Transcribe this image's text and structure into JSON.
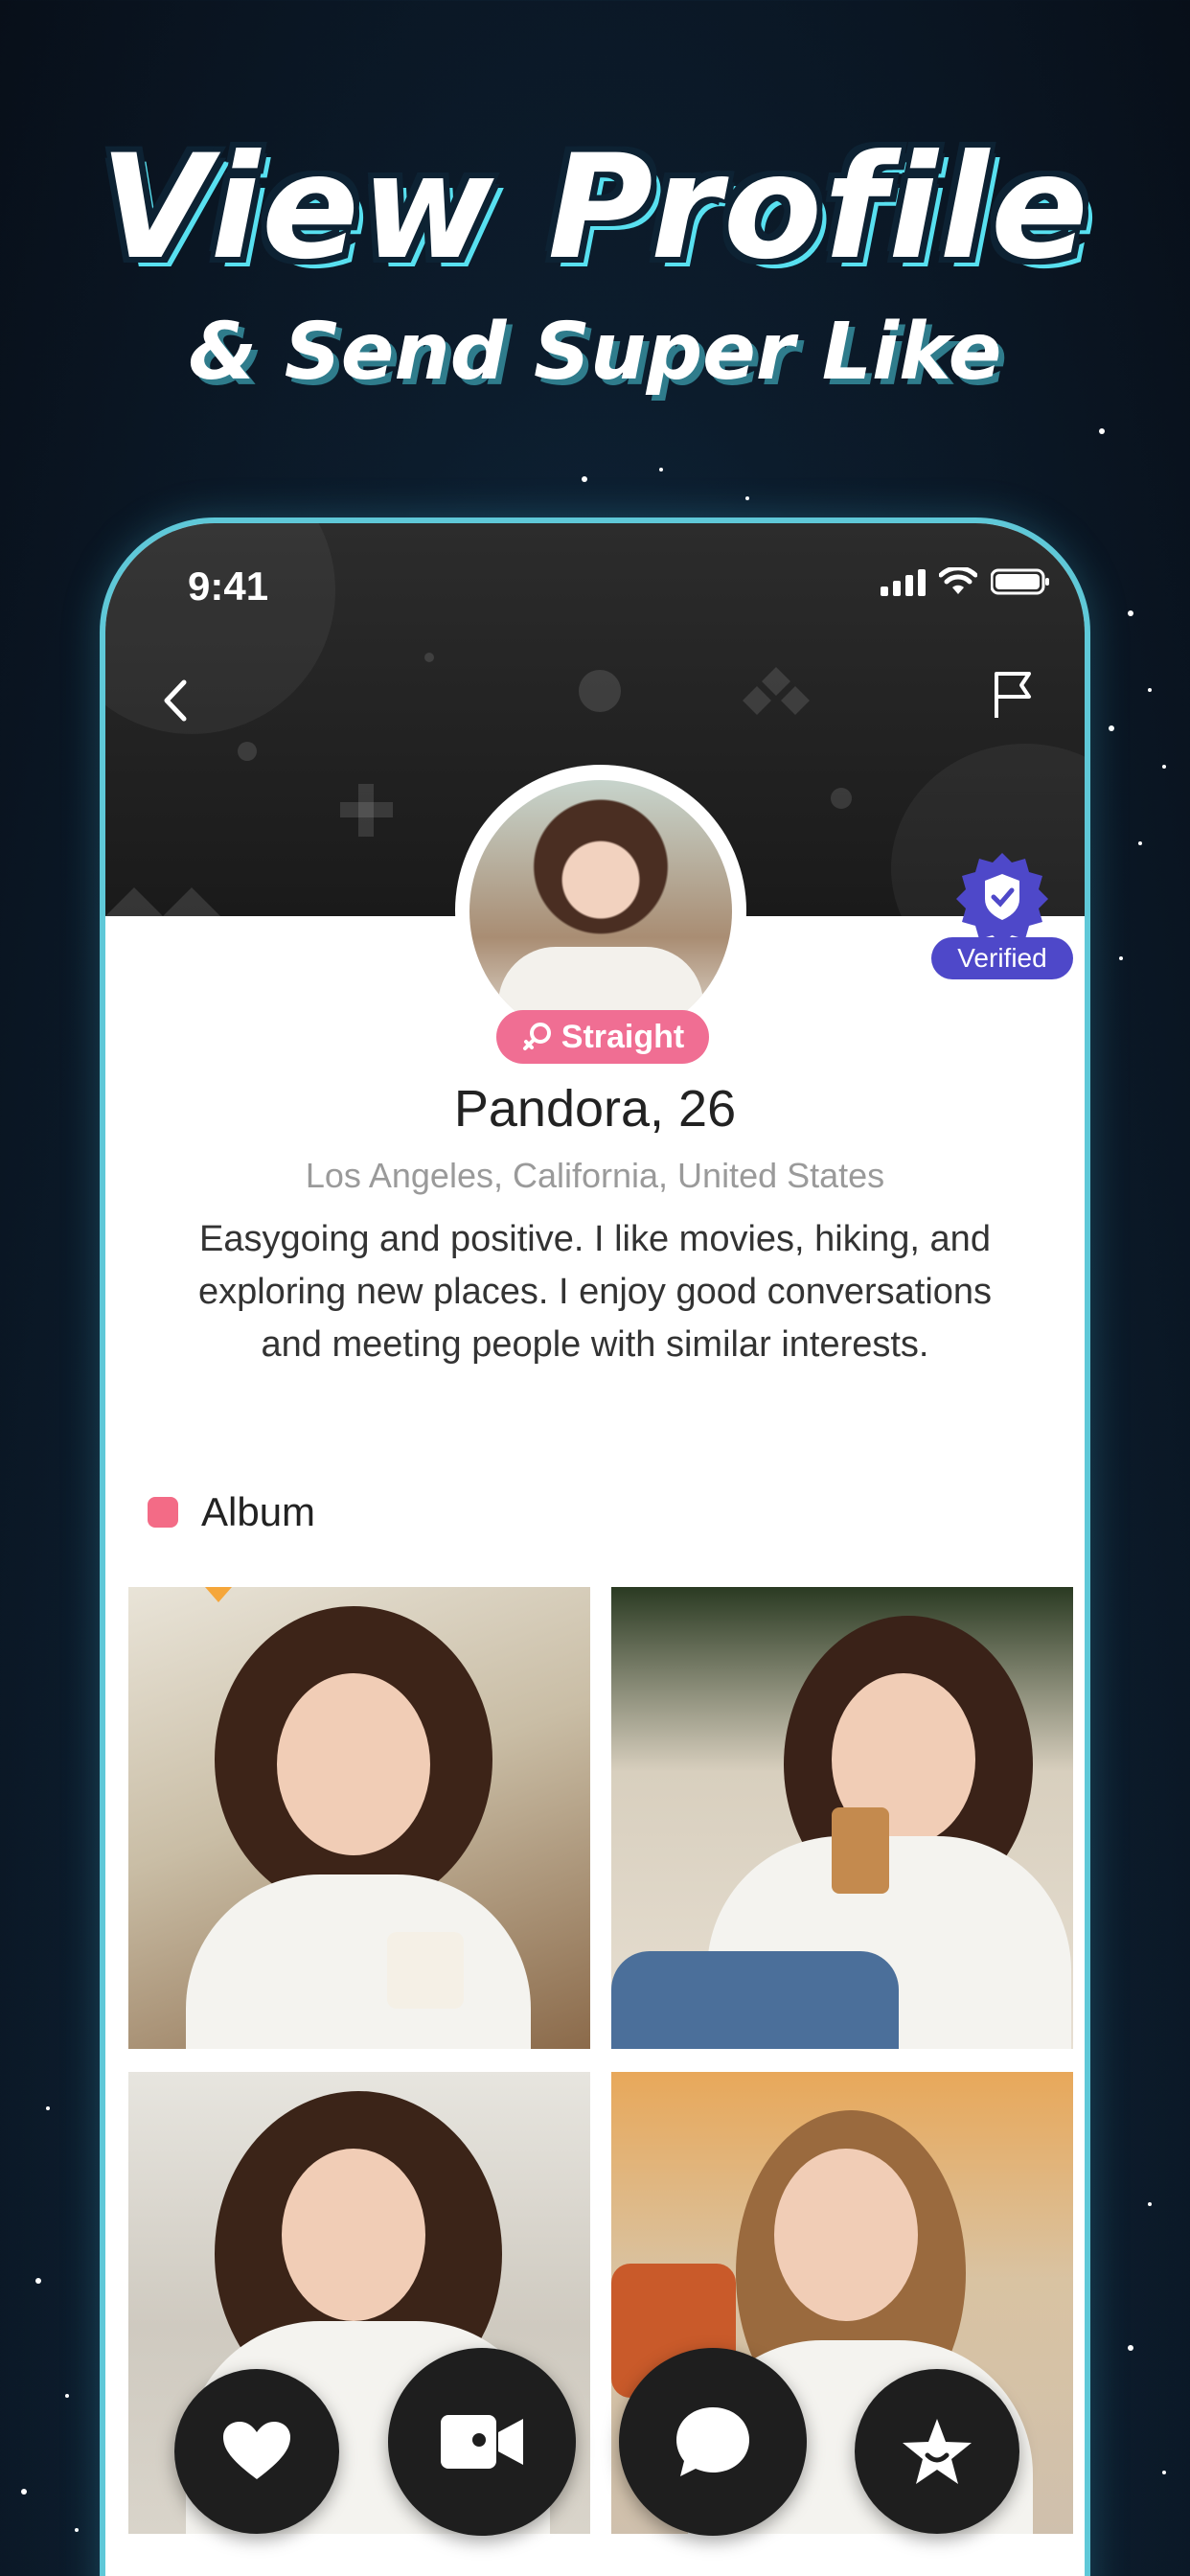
{
  "hero": {
    "headline": "View Profile",
    "subline": "& Send Super Like"
  },
  "status_bar": {
    "time": "9:41"
  },
  "header": {
    "back_icon": "chevron-left-icon",
    "report_icon": "flag-icon"
  },
  "profile": {
    "verified_label": "Verified",
    "orientation_label": "Straight",
    "name": "Pandora, 26",
    "location": "Los Angeles, California, United States",
    "bio": "Easygoing and positive. I like movies, hiking, and exploring new places. I enjoy good conversations and meeting people with similar interests."
  },
  "album": {
    "title": "Album",
    "photo_count_visible": 4
  },
  "actions": {
    "like_icon": "heart-icon",
    "video_icon": "video-camera-icon",
    "chat_icon": "chat-bubble-icon",
    "super_like_icon": "star-icon"
  },
  "colors": {
    "accent_pink": "#f06e93",
    "verified_purple": "#4e48c9",
    "frame_cyan": "#5fc8d8",
    "album_dot": "#f36b86"
  }
}
